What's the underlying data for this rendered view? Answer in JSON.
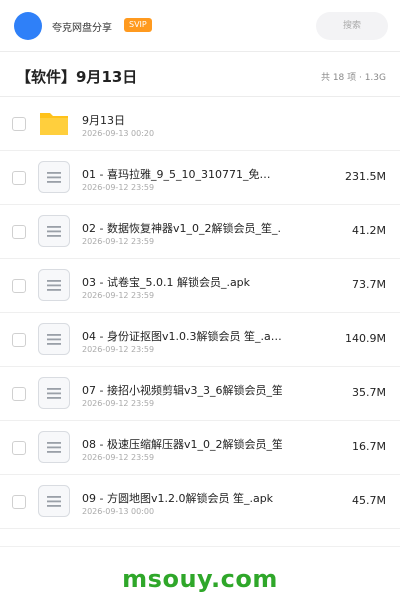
{
  "header": {
    "username": "夸克网盘分享",
    "badge": "SVIP",
    "search_placeholder": "搜索"
  },
  "folder": {
    "title": "【软件】9月13日",
    "meta": "共 18 项 · 1.3G"
  },
  "files": [
    {
      "type": "folder",
      "name": "9月13日",
      "date": "2026-09-13 00:20",
      "size": ""
    },
    {
      "type": "file",
      "name": "01 - 喜玛拉雅_9_5_10_310771_免…",
      "date": "2026-09-12 23:59",
      "size": "231.5M"
    },
    {
      "type": "file",
      "name": "02 - 数据恢复神器v1_0_2解锁会员_笙_.…",
      "date": "2026-09-12 23:59",
      "size": "41.2M"
    },
    {
      "type": "file",
      "name": "03 - 试卷宝_5.0.1 解锁会员_.apk",
      "date": "2026-09-12 23:59",
      "size": "73.7M"
    },
    {
      "type": "file",
      "name": "04 - 身份证抠图v1.0.3解锁会员 笙_.a…",
      "date": "2026-09-12 23:59",
      "size": "140.9M"
    },
    {
      "type": "file",
      "name": "07 - 接招小视频剪辑v3_3_6解锁会员_笙_…",
      "date": "2026-09-12 23:59",
      "size": "35.7M"
    },
    {
      "type": "file",
      "name": "08 - 极速压缩解压器v1_0_2解锁会员_笙_…",
      "date": "2026-09-12 23:59",
      "size": "16.7M"
    },
    {
      "type": "file",
      "name": "09 - 方圆地图v1.2.0解锁会员 笙_.apk",
      "date": "2026-09-13 00:00",
      "size": "45.7M"
    }
  ],
  "watermark": "msouy.com",
  "colors": {
    "accent": "#2f80f8",
    "badge": "#ff9a1f",
    "folder": "#ffc21a",
    "watermark": "#2fa72a"
  }
}
